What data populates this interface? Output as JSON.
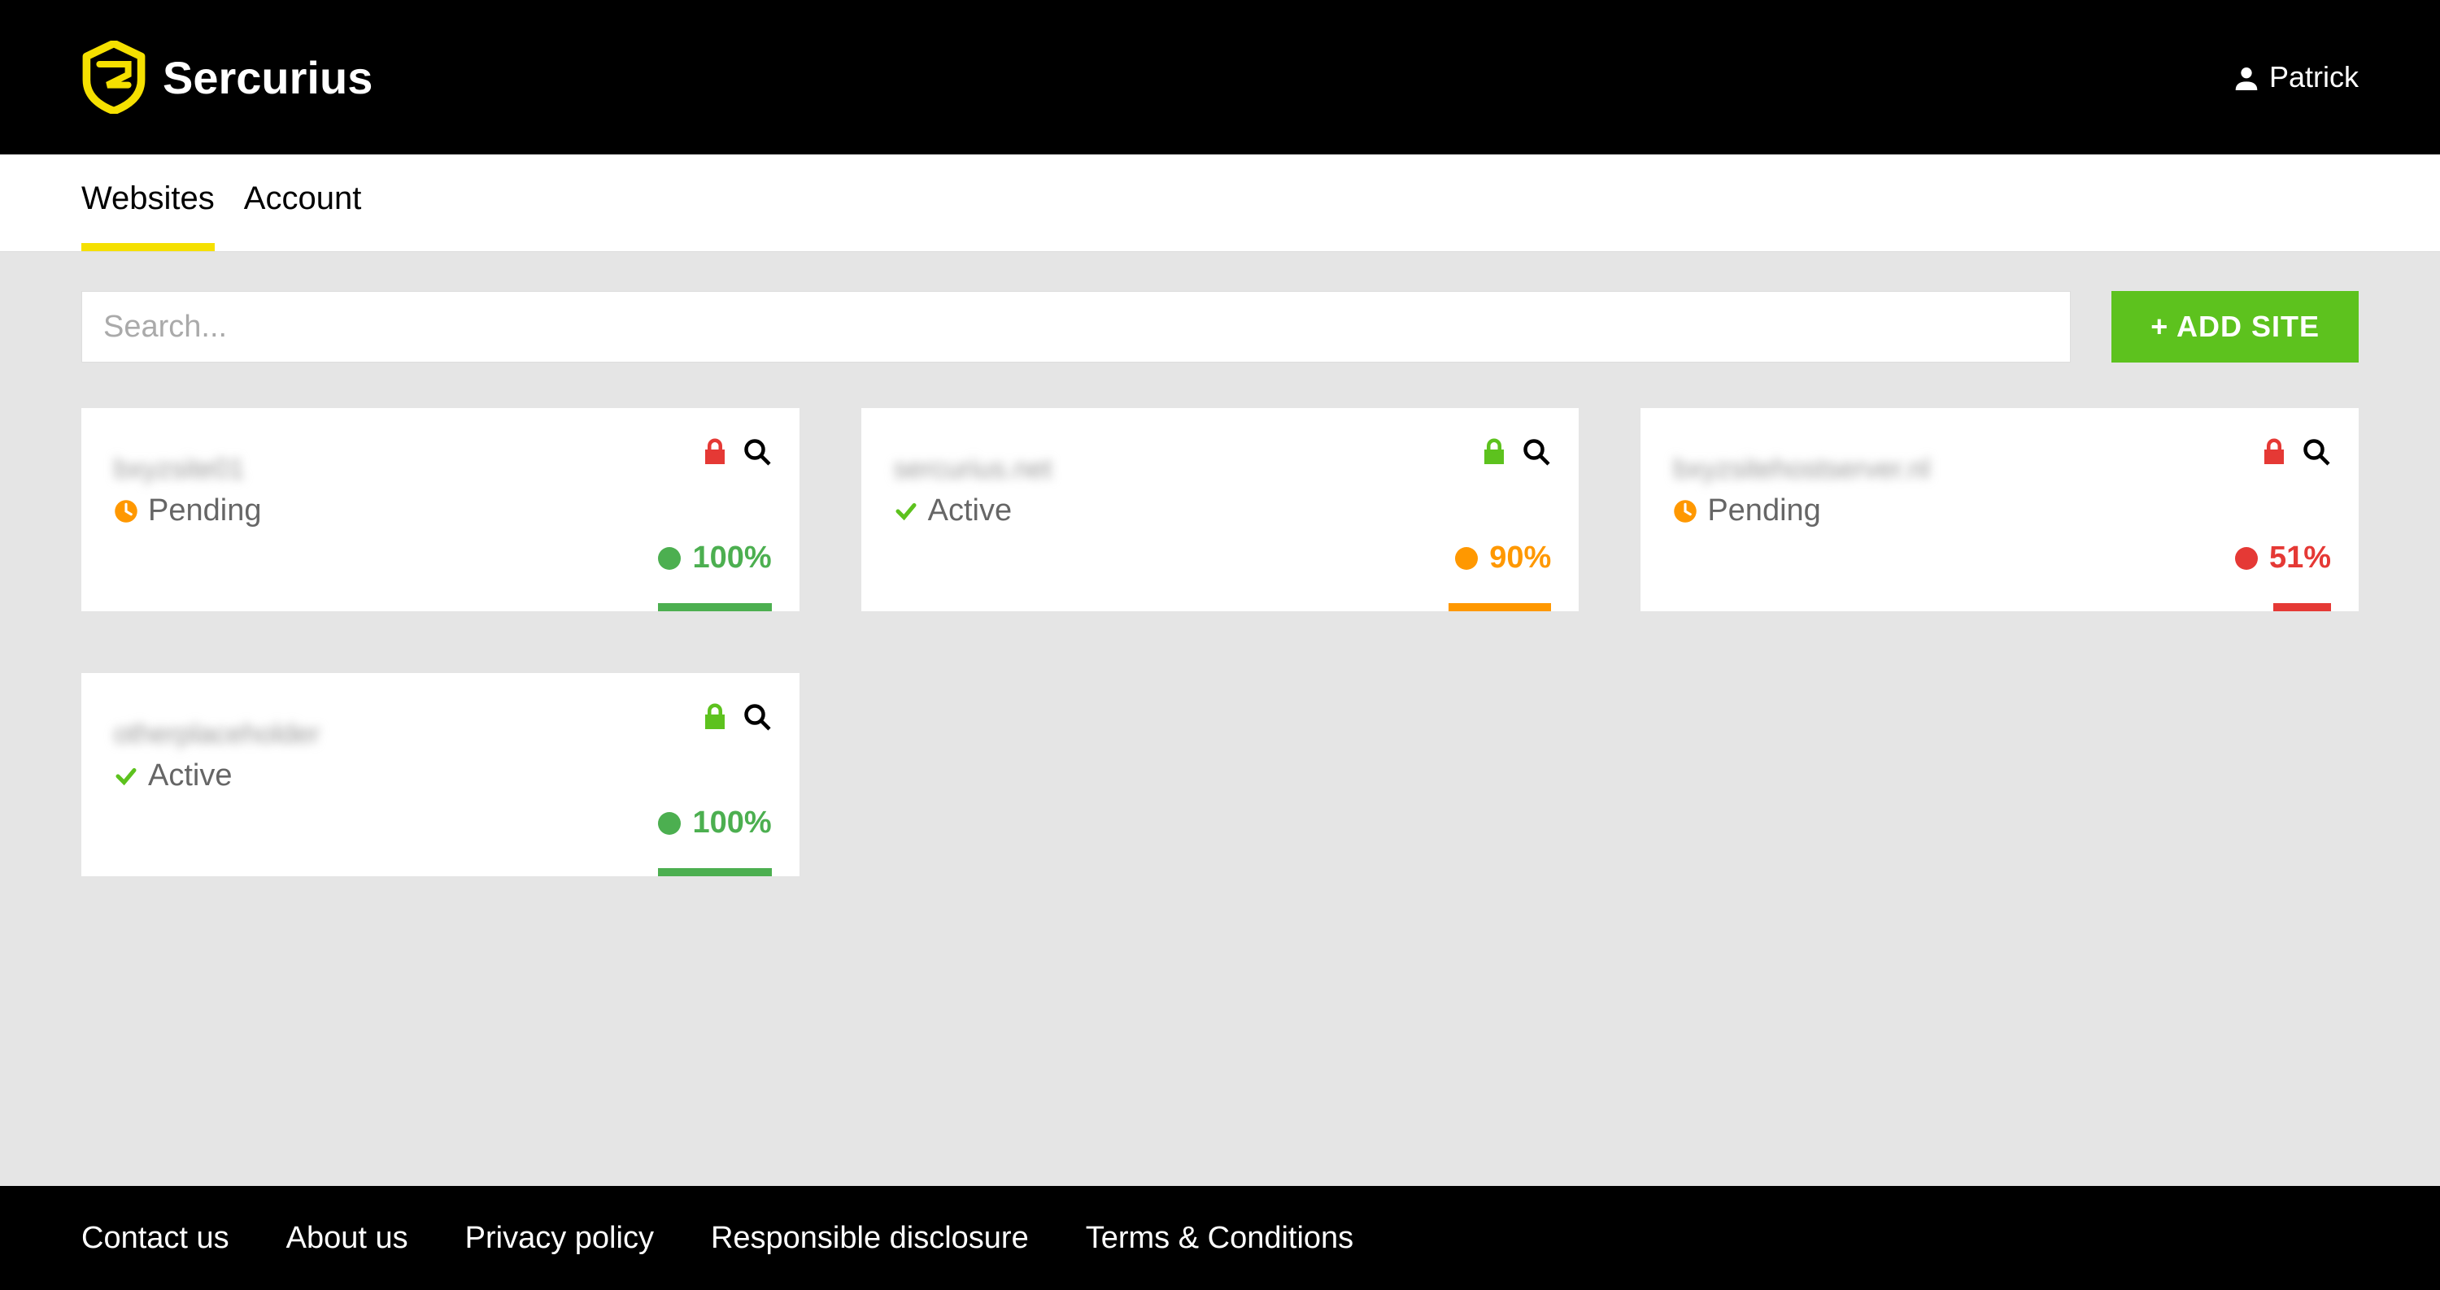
{
  "header": {
    "brand": "Sercurius",
    "user_name": "Patrick"
  },
  "tabs": [
    {
      "label": "Websites",
      "active": true
    },
    {
      "label": "Account",
      "active": false
    }
  ],
  "search": {
    "placeholder": "Search..."
  },
  "add_site_label": "+ ADD SITE",
  "cards": [
    {
      "site_name": "bxyzsite01",
      "status": "Pending",
      "status_type": "pending",
      "lock": "red",
      "score": "100%",
      "score_color": "green"
    },
    {
      "site_name": "sercurius.net",
      "status": "Active",
      "status_type": "active",
      "lock": "green",
      "score": "90%",
      "score_color": "orange"
    },
    {
      "site_name": "bxyzsitehostserver.nl",
      "status": "Pending",
      "status_type": "pending",
      "lock": "red",
      "score": "51%",
      "score_color": "red"
    },
    {
      "site_name": "otherplaceholder",
      "status": "Active",
      "status_type": "active",
      "lock": "green",
      "score": "100%",
      "score_color": "green"
    }
  ],
  "footer_links": [
    "Contact us",
    "About us",
    "Privacy policy",
    "Responsible disclosure",
    "Terms & Conditions"
  ],
  "colors": {
    "accent_yellow": "#f5e000",
    "green": "#4caf50",
    "orange": "#ff9800",
    "red": "#e53935",
    "add_btn": "#5dc21e"
  }
}
